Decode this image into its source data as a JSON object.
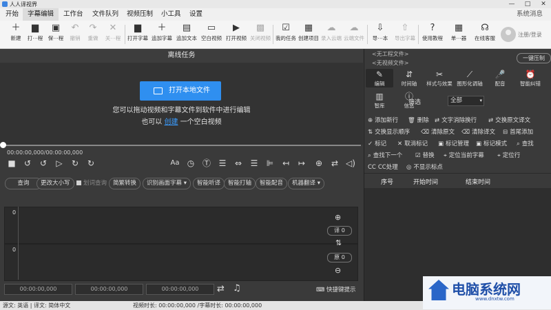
{
  "window": {
    "title": "人人译视界",
    "controls": [
      "—",
      "□",
      "✕"
    ]
  },
  "menu": {
    "items": [
      "开始",
      "字幕编辑",
      "工作台",
      "文件队列",
      "视频压制",
      "小工具",
      "设置"
    ],
    "active": "字幕编辑",
    "system_msg": "系统消息"
  },
  "toolbar": {
    "items": [
      {
        "icon": "new-file-icon",
        "glyph": "＋",
        "label": "新建",
        "enabled": true
      },
      {
        "icon": "folder-icon",
        "glyph": "▆",
        "label": "打⋯程",
        "enabled": true
      },
      {
        "icon": "save-icon",
        "glyph": "▣",
        "label": "保⋯程",
        "enabled": true
      },
      {
        "icon": "undo-icon",
        "glyph": "↶",
        "label": "撤销",
        "enabled": false
      },
      {
        "icon": "redo-icon",
        "glyph": "↷",
        "label": "重做",
        "enabled": false
      },
      {
        "icon": "close-project-icon",
        "glyph": "✕",
        "label": "关⋯程",
        "enabled": false
      },
      {
        "icon": "open-subtitle-icon",
        "glyph": "▆",
        "label": "打开字幕",
        "enabled": true
      },
      {
        "icon": "add-subtitle-icon",
        "glyph": "＋",
        "label": "追加字幕",
        "enabled": true
      },
      {
        "icon": "add-text-icon",
        "glyph": "▤",
        "label": "追加文本",
        "enabled": true
      },
      {
        "icon": "blank-video-icon",
        "glyph": "▭",
        "label": "空白视频",
        "enabled": true
      },
      {
        "icon": "open-video-icon",
        "glyph": "▶",
        "label": "打开视频",
        "enabled": true
      },
      {
        "icon": "close-video-icon",
        "glyph": "▩",
        "label": "关闭视频",
        "enabled": false
      },
      {
        "icon": "my-tasks-icon",
        "glyph": "☑",
        "label": "我的任务",
        "enabled": true
      },
      {
        "icon": "create-project-icon",
        "glyph": "▦",
        "label": "创建项目",
        "enabled": true
      },
      {
        "icon": "cloud-join-icon",
        "glyph": "☁",
        "label": "录入云端",
        "enabled": false
      },
      {
        "icon": "cloud-file-icon",
        "glyph": "☁",
        "label": "云端文件",
        "enabled": false
      },
      {
        "icon": "import-icon",
        "glyph": "⇩",
        "label": "导⋯本",
        "enabled": true
      },
      {
        "icon": "export-subtitle-icon",
        "glyph": "⇧",
        "label": "导出字幕",
        "enabled": false
      },
      {
        "icon": "help-icon",
        "glyph": "?",
        "label": "使用教程",
        "enabled": true
      },
      {
        "icon": "calculator-icon",
        "glyph": "▦",
        "label": "单⋯器",
        "enabled": true
      },
      {
        "icon": "headset-icon",
        "glyph": "☊",
        "label": "在线客服",
        "enabled": true
      }
    ],
    "login": "注册/登录"
  },
  "task": {
    "header": "离线任务",
    "open_button": "打开本地文件",
    "hint_line1": "您可以拖动视频和字幕文件到软件中进行编辑",
    "hint_prefix": "也可以",
    "hint_link": "创建",
    "hint_suffix": "一个空白视频"
  },
  "player": {
    "timecode": "00:00:00,000/00:00:00,000"
  },
  "functions": {
    "query": "查询",
    "resize": "更改大小写",
    "underline_query": "划词查询",
    "convert": "简繁转换",
    "recognize": "识别画面字幕",
    "listen": "智能听译",
    "axis": "智能打轴",
    "dub": "智能配音",
    "mt": "机器翻译"
  },
  "tracks": {
    "top_count": "0",
    "bottom_count": "0",
    "translation_badge": "译 0",
    "original_badge": "原 0",
    "times": [
      "00:00:00,000",
      "00:00:00,000",
      "00:00:00,000"
    ],
    "shortcut": "快捷键提示"
  },
  "status": {
    "left": "源文: 英语 | 译文: 简体中文",
    "middle": "视频时长: 00:00:00,000 /字幕时长: 00:00:00,000"
  },
  "right": {
    "project_file": "<无工程文件>",
    "video_file": "<无视频文件>",
    "burn_button": "一键压制",
    "tools": [
      {
        "icon": "edit-icon",
        "glyph": "✎",
        "label": "编辑",
        "active": true
      },
      {
        "icon": "timeline-icon",
        "glyph": "⇵",
        "label": "时间轴",
        "active": false
      },
      {
        "icon": "style-icon",
        "glyph": "✂",
        "label": "样式与效果",
        "active": false
      },
      {
        "icon": "graph-icon",
        "glyph": "⟋",
        "label": "图形化调轴",
        "active": false
      },
      {
        "icon": "mic-icon",
        "glyph": "🎤",
        "label": "配音",
        "active": false
      },
      {
        "icon": "alarm-icon",
        "glyph": "⏰",
        "label": "智能纠错",
        "active": false
      },
      {
        "icon": "library-icon",
        "glyph": "▥",
        "label": "智库",
        "active": false
      },
      {
        "icon": "info-icon",
        "glyph": "ⓘ",
        "label": "信息",
        "active": false
      }
    ],
    "filter_label": "筛选",
    "filter_value": "全部",
    "actions": [
      {
        "icon": "add-row-icon",
        "glyph": "⊕",
        "label": "添加新行"
      },
      {
        "icon": "delete-icon",
        "glyph": "🗑",
        "label": "删除"
      },
      {
        "icon": "wrap-icon",
        "glyph": "⇄",
        "label": "文字消除换行"
      },
      {
        "icon": "swap-icon",
        "glyph": "⇄",
        "label": "交换原文译文"
      },
      {
        "icon": "order-icon",
        "glyph": "⇅",
        "label": "交换显示顺序"
      },
      {
        "icon": "eraser-icon",
        "glyph": "⌫",
        "label": "清除原文"
      },
      {
        "icon": "eraser2-icon",
        "glyph": "⌫",
        "label": "清除译文"
      },
      {
        "icon": "tail-icon",
        "glyph": "⊟",
        "label": "首尾添加"
      },
      {
        "icon": "pin-icon",
        "glyph": "✓",
        "label": "标记"
      },
      {
        "icon": "unpin-icon",
        "glyph": "✕",
        "label": "取消标记"
      },
      {
        "icon": "mark-manage-icon",
        "glyph": "▣",
        "label": "标记管理"
      },
      {
        "icon": "mark-mode-icon",
        "glyph": "▣",
        "label": "标记模式"
      },
      {
        "icon": "search-icon",
        "glyph": "⌕",
        "label": "查找"
      },
      {
        "icon": "find-next-icon",
        "glyph": "⌕",
        "label": "查找下一个"
      },
      {
        "icon": "replace-icon",
        "glyph": "☑",
        "label": "替换"
      },
      {
        "icon": "locate-current-icon",
        "glyph": "⌖",
        "label": "定位当前字幕"
      },
      {
        "icon": "locate-row-icon",
        "glyph": "⌖",
        "label": "定位行"
      },
      {
        "icon": "cc-icon",
        "glyph": "CC",
        "label": "CC处理"
      },
      {
        "icon": "eye-off-icon",
        "glyph": "◎",
        "label": "不显示标点"
      }
    ],
    "columns": [
      "序号",
      "开始时间",
      "结束时间"
    ]
  },
  "watermark": {
    "title": "电脑系统网",
    "sub": "www.dnxtw.com"
  }
}
